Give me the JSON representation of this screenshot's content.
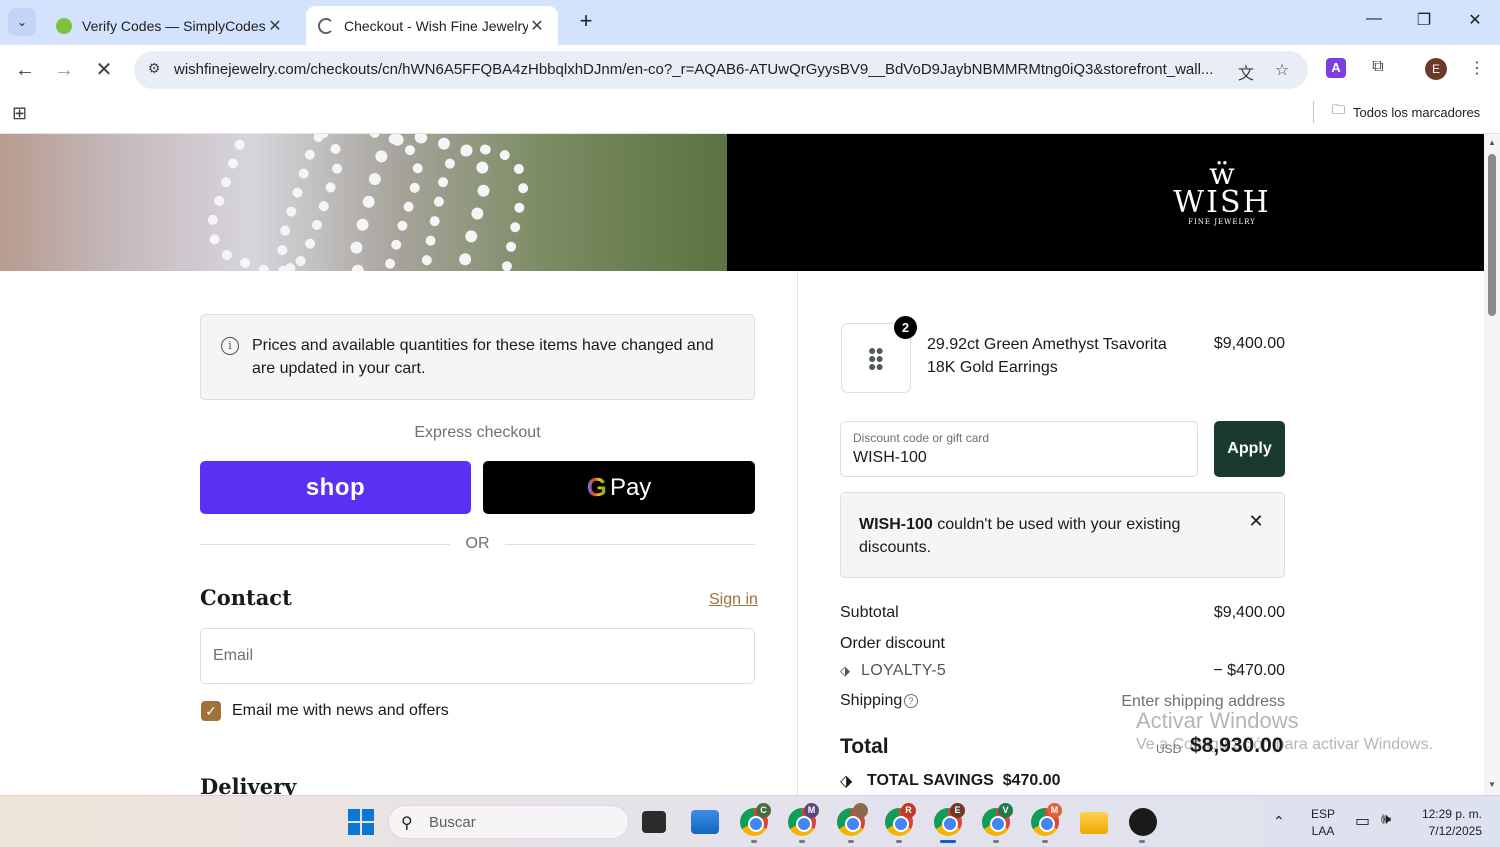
{
  "browser": {
    "tabs": [
      {
        "title": "Verify Codes — SimplyCodes",
        "active": false
      },
      {
        "title": "Checkout - Wish Fine Jewelry",
        "active": true
      }
    ],
    "url": "wishfinejewelry.com/checkouts/cn/hWN6A5FFQBA4zHbbqlxhDJnm/en-co?_r=AQAB6-ATUwQrGyysBV9__BdVoD9JaybNBMMRMtng0iQ3&storefront_wall...",
    "bookmarks_all": "Todos los marcadores",
    "profile_initial": "E"
  },
  "brand": {
    "name": "WISH",
    "subtitle": "FINE JEWELRY"
  },
  "checkout": {
    "notice": "Prices and available quantities for these items have changed and are updated in your cart.",
    "express_checkout": "Express checkout",
    "shop_pay_label": "shop",
    "gpay_label": "Pay",
    "or_label": "OR",
    "contact_heading": "Contact",
    "sign_in": "Sign in",
    "email_placeholder": "Email",
    "newsletter_label": "Email me with news and offers",
    "newsletter_checked": true,
    "delivery_heading": "Delivery"
  },
  "summary": {
    "product": {
      "name": "29.92ct Green Amethyst Tsavorita 18K Gold Earrings",
      "price": "$9,400.00",
      "quantity": "2"
    },
    "discount_label": "Discount code or gift card",
    "discount_value": "WISH-100",
    "apply_label": "Apply",
    "error": {
      "code": "WISH-100",
      "message": " couldn't be used with your existing discounts."
    },
    "subtotal_label": "Subtotal",
    "subtotal_value": "$9,400.00",
    "order_discount_label": "Order discount",
    "loyalty_code": "LOYALTY-5",
    "loyalty_value": "− $470.00",
    "shipping_label": "Shipping",
    "shipping_value": "Enter shipping address",
    "total_label": "Total",
    "total_currency": "USD",
    "total_value": "$8,930.00",
    "savings_label": "TOTAL SAVINGS",
    "savings_value": "$470.00"
  },
  "watermark": {
    "line1": "Activar Windows",
    "line2": "Ve a Configuración para activar Windows."
  },
  "taskbar": {
    "search_placeholder": "Buscar",
    "chrome_profiles": [
      "C",
      "M",
      "",
      "R",
      "E",
      "V",
      "M"
    ],
    "lang_line1": "ESP",
    "lang_line2": "LAA",
    "time": "12:29 p. m.",
    "date": "7/12/2025"
  },
  "colors": {
    "tab_strip": "#d3e3fd",
    "shop_pay": "#5a31f4",
    "apply": "#1b3a2e",
    "accent_link": "#a0713a"
  }
}
